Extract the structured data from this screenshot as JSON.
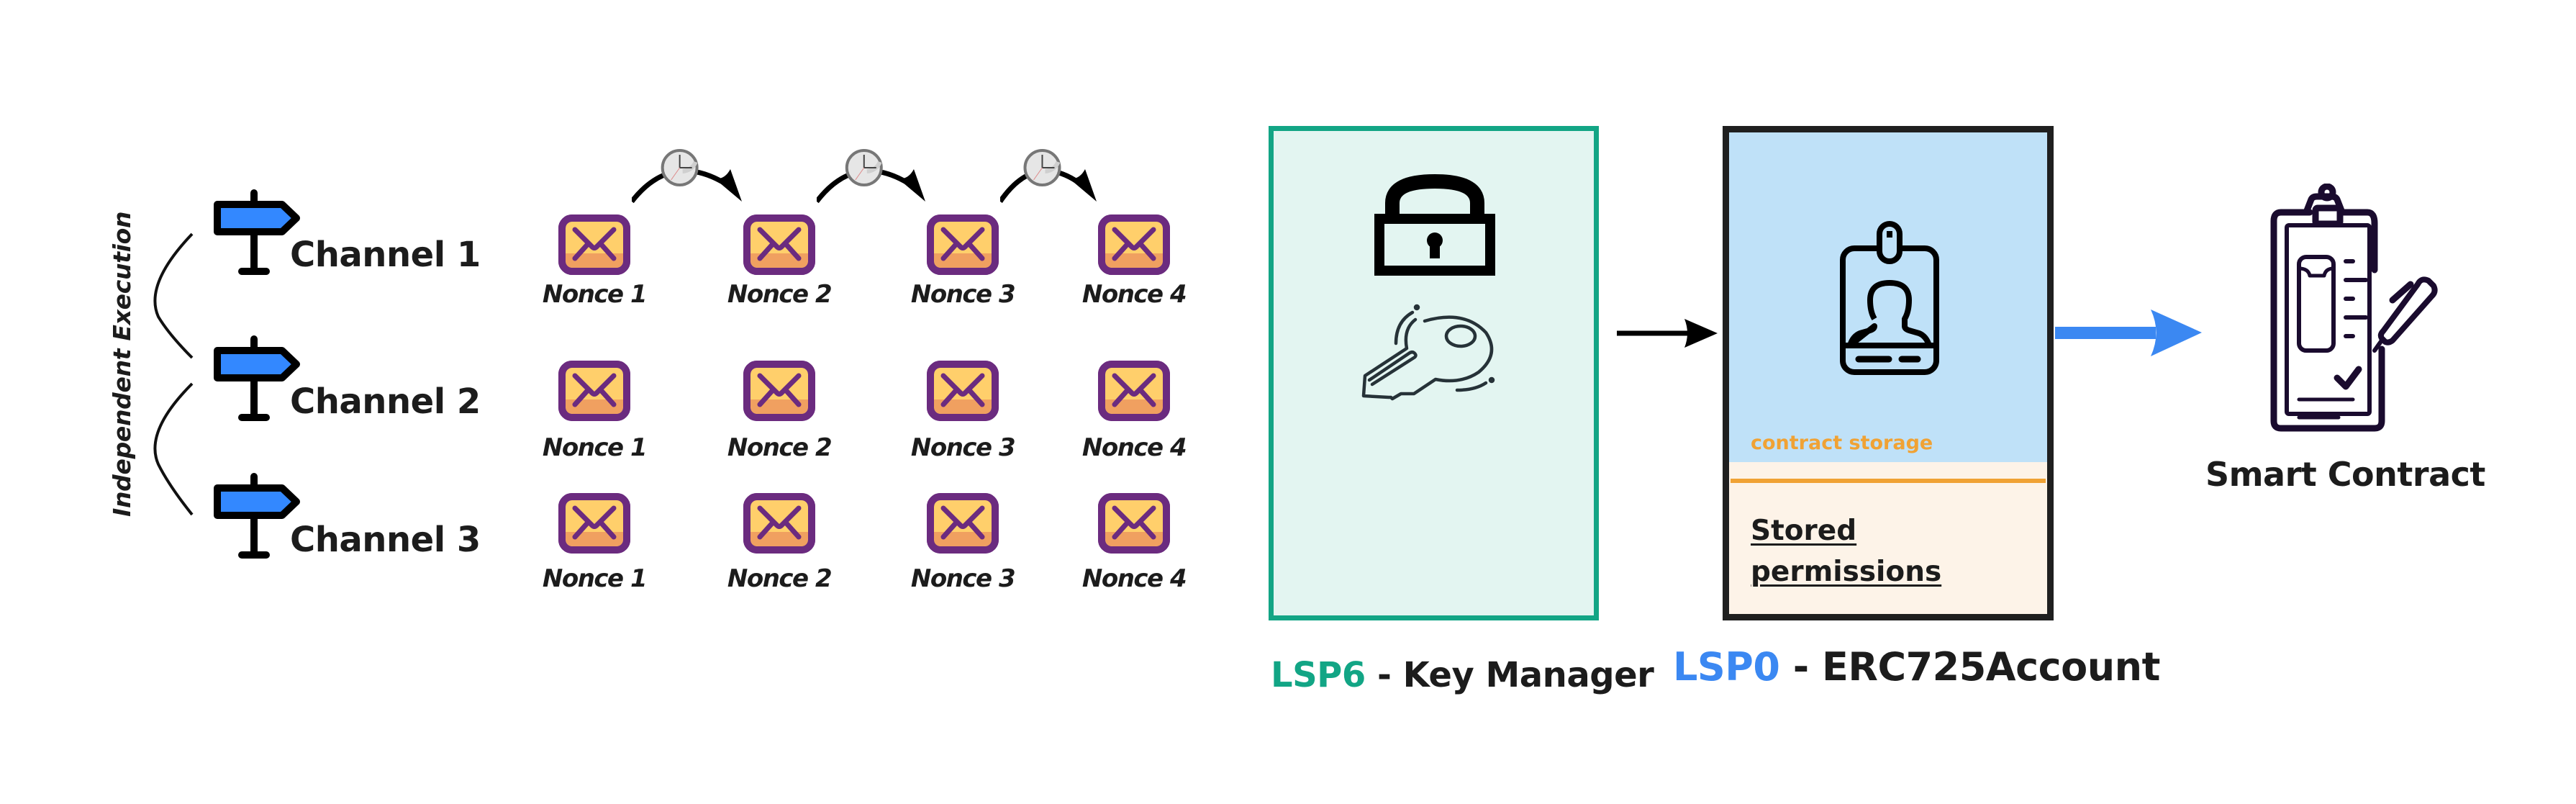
{
  "left_panel": {
    "side_label": "Independent Execution",
    "channels": [
      {
        "label": "Channel 1"
      },
      {
        "label": "Channel 2"
      },
      {
        "label": "Channel 3"
      }
    ]
  },
  "nonce_rows": [
    {
      "channel": "Channel 1",
      "sequential": true,
      "nonces": [
        "Nonce 1",
        "Nonce 2",
        "Nonce 3",
        "Nonce 4"
      ]
    },
    {
      "channel": "Channel 2",
      "sequential": false,
      "nonces": [
        "Nonce 1",
        "Nonce 2",
        "Nonce 3",
        "Nonce 4"
      ]
    },
    {
      "channel": "Channel 3",
      "sequential": false,
      "nonces": [
        "Nonce 1",
        "Nonce 2",
        "Nonce 3",
        "Nonce 4"
      ]
    }
  ],
  "key_manager": {
    "prefix": "LSP6",
    "separator": " - ",
    "name": "Key Manager",
    "icons": [
      "lock-icon",
      "key-icon"
    ]
  },
  "account": {
    "prefix": "LSP0",
    "separator": " - ",
    "name": "ERC725Account",
    "storage_label": "contract storage",
    "permissions_label": "Stored permissions",
    "icons": [
      "id-badge-icon"
    ]
  },
  "target": {
    "label": "Smart Contract",
    "icons": [
      "clipboard-contract-icon"
    ]
  },
  "colors": {
    "sign_blue": "#3388ff",
    "envelope_purple": "#6b2b7f",
    "envelope_yellow": "#ffcf6b",
    "envelope_orange": "#f0a060",
    "lsp6_green": "#12a585",
    "lsp0_blue": "#3b88f2",
    "storage_orange": "#f0a234",
    "account_blue_bg": "#bfe1f8",
    "account_beige_bg": "#fdf3e8",
    "key_manager_bg": "#e3f5f1",
    "flow_arrow_blue": "#3b88f2"
  }
}
